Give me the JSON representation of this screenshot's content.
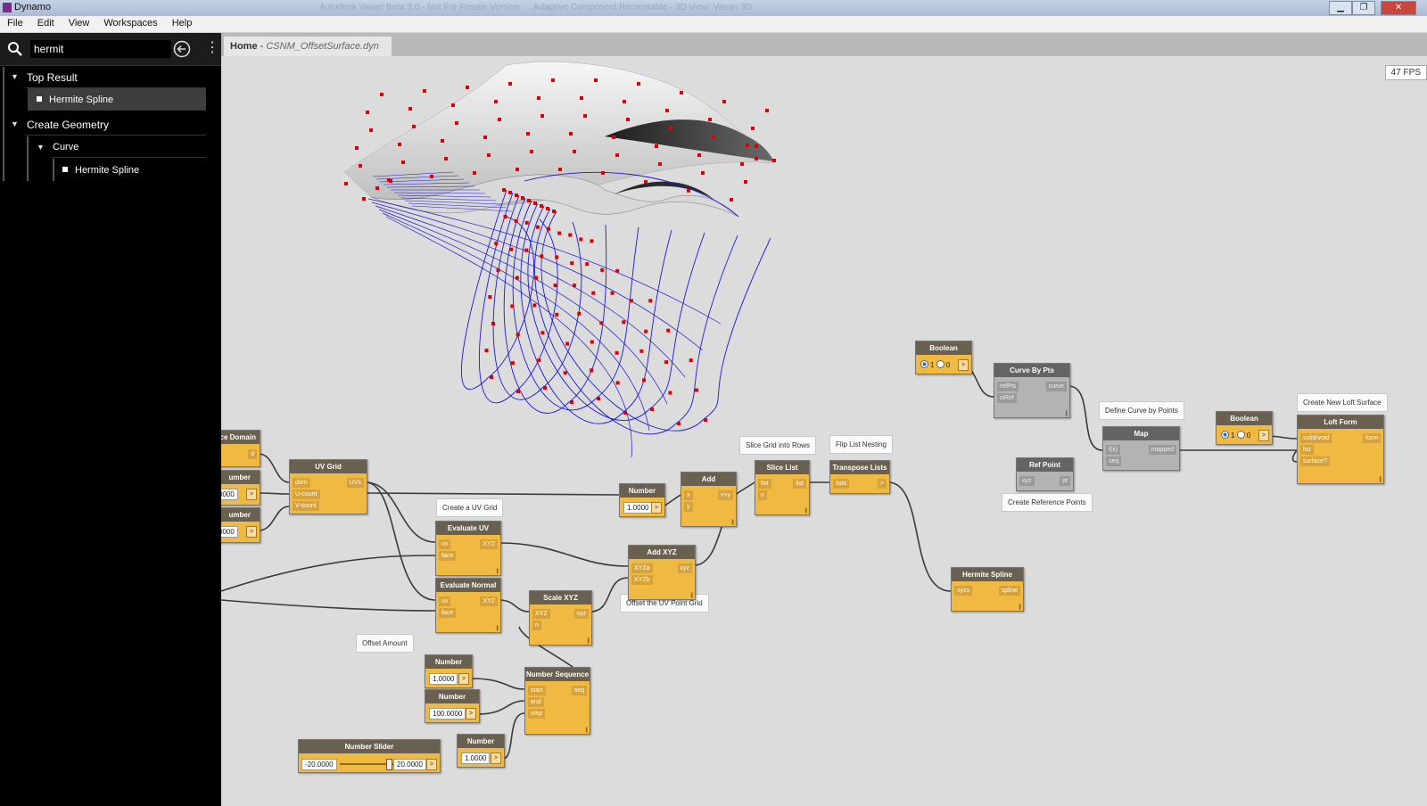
{
  "app": {
    "title": "Dynamo",
    "ghost_titles": [
      "Autodesk Vasari Beta 3.0 - Not For Resale Version",
      "Adaptive Component Recreatable - 3D View: Vasari 3D"
    ]
  },
  "menu": [
    "File",
    "Edit",
    "View",
    "Workspaces",
    "Help"
  ],
  "search": {
    "value": "hermit"
  },
  "library": {
    "top_result": "Top Result",
    "top_item": "Hermite Spline",
    "category": "Create Geometry",
    "subcategory": "Curve",
    "sub_item": "Hermite Spline"
  },
  "tab": {
    "home": "Home",
    "separator": " - ",
    "file": "CSNM_OffsetSurface.dyn"
  },
  "fps": "47 FPS",
  "notes": {
    "uvgrid": "Create a UV Grid",
    "slice": "Slice Grid into Rows",
    "flip": "Flip List Nesting",
    "define": "Define Curve by Points",
    "loft": "Create New Loft Surface",
    "refpts": "Create Reference Points",
    "offset": "Offset the UV Point Grid",
    "amount": "Offset Amount"
  },
  "nodes": {
    "domain": {
      "title": "ce Domain",
      "out": "d"
    },
    "num_a": {
      "title": "umber",
      "value": "0000"
    },
    "num_b": {
      "title": "umber",
      "value": "0000"
    },
    "uvgrid": {
      "title": "UV Grid",
      "in1": "dom",
      "in2": "U-count",
      "in3": "V-count",
      "out": "UVs"
    },
    "evaluv": {
      "title": "Evaluate UV",
      "in1": "uv",
      "in2": "face",
      "out": "XYZ"
    },
    "evalnorm": {
      "title": "Evaluate Normal",
      "in1": "uv",
      "in2": "face",
      "out": "XYZ"
    },
    "scale": {
      "title": "Scale XYZ",
      "in1": "XYZ",
      "in2": "n",
      "out": "xyz"
    },
    "addxyz": {
      "title": "Add XYZ",
      "in1": "XYZa",
      "in2": "XYZb",
      "out": "xyz"
    },
    "number1": {
      "title": "Number",
      "value": "1.0000"
    },
    "add": {
      "title": "Add",
      "in1": "x",
      "in2": "y",
      "out": "x+y"
    },
    "slice": {
      "title": "Slice List",
      "in1": "list",
      "in2": "n",
      "out": "list"
    },
    "transpose": {
      "title": "Transpose Lists",
      "in1": "lists",
      "out": ">"
    },
    "boolean1": {
      "title": "Boolean",
      "opt1": "1",
      "opt2": "0"
    },
    "curvepts": {
      "title": "Curve By Pts",
      "in1": "refPts",
      "in2": "isRef",
      "out": "curve"
    },
    "map": {
      "title": "Map",
      "in1": "f(x)",
      "in2": "seq",
      "out": "mapped"
    },
    "refpoint": {
      "title": "Ref Point",
      "in1": "xyz",
      "out": "pt"
    },
    "boolean2": {
      "title": "Boolean",
      "opt1": "1",
      "opt2": "0"
    },
    "loft": {
      "title": "Loft Form",
      "in1": "solid/void",
      "in2": "list",
      "in3": "surface?",
      "out": "form"
    },
    "hermite": {
      "title": "Hermite Spline",
      "in1": "xyzs",
      "out": "spline"
    },
    "numstart": {
      "title": "Number",
      "value": "1.0000"
    },
    "numend": {
      "title": "Number",
      "value": "100.0000"
    },
    "numstep": {
      "title": "Number",
      "value": "1.0000"
    },
    "numseq": {
      "title": "Number Sequence",
      "in1": "start",
      "in2": "end",
      "in3": "step",
      "out": "seq"
    },
    "slider": {
      "title": "Number Slider",
      "min": "-20.0000",
      "max": "20.0000",
      "level": 0.92
    }
  },
  "colors": {
    "node_body": "#f0b942",
    "node_header": "#69604f",
    "canvas": "#dcdcdc",
    "curve": "#1a1ad0",
    "point": "#e00000"
  }
}
